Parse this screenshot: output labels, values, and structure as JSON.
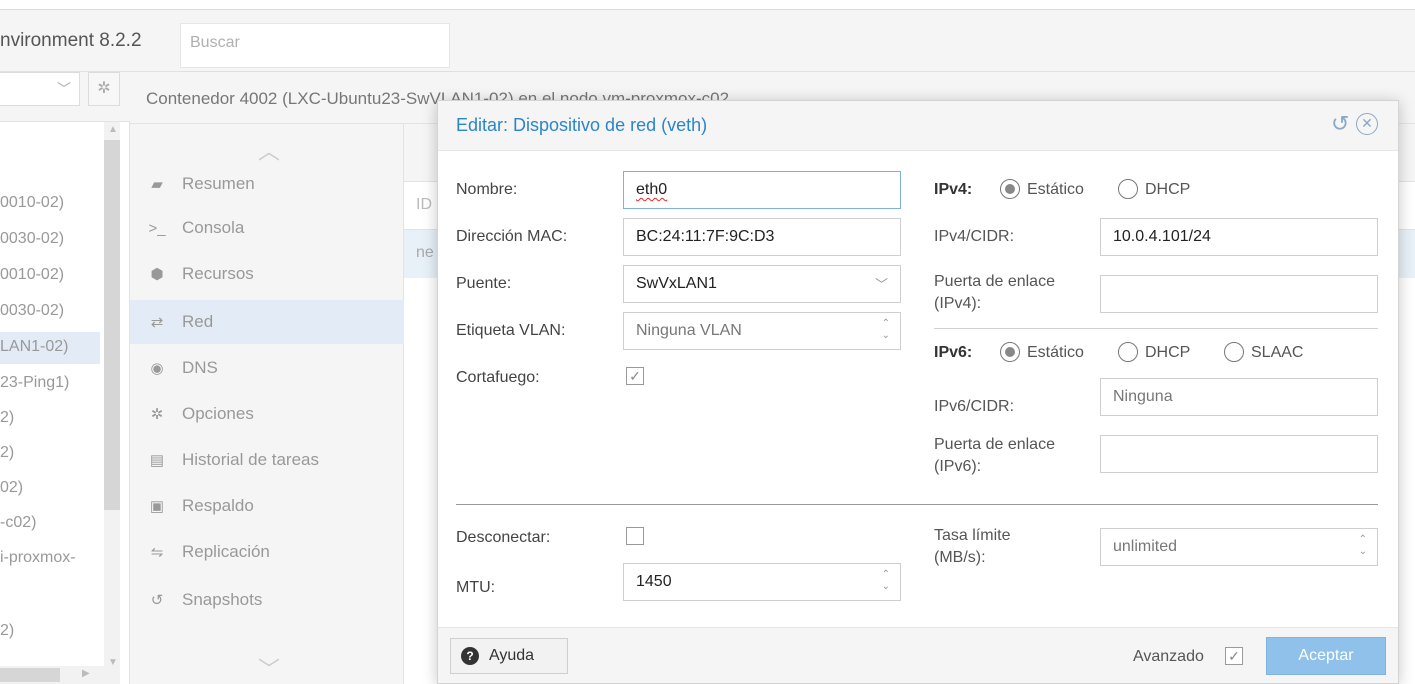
{
  "app": {
    "product_title": "nvironment 8.2.2",
    "search_placeholder": "Buscar"
  },
  "tree": {
    "items": [
      "0010-02)",
      "0030-02)",
      "0010-02)",
      "0030-02)",
      "LAN1-02)",
      "23-Ping1)",
      "2)",
      "2)",
      "02)",
      "-c02)",
      "i-proxmox-",
      "2)"
    ]
  },
  "container": {
    "title": "Contenedor 4002 (LXC-Ubuntu23-SwVLAN1-02) en el nodo vm-proxmox-c02",
    "nav": [
      "Resumen",
      "Consola",
      "Recursos",
      "Red",
      "DNS",
      "Opciones",
      "Historial de tareas",
      "Respaldo",
      "Replicación",
      "Snapshots"
    ],
    "active_nav": "Red",
    "grid_header": "ID",
    "grid_row": "ne"
  },
  "dialog": {
    "title": "Editar: Dispositivo de red (veth)",
    "left": {
      "name_label": "Nombre:",
      "name_value": "eth0",
      "mac_label": "Dirección MAC:",
      "mac_value": "BC:24:11:7F:9C:D3",
      "bridge_label": "Puente:",
      "bridge_value": "SwVxLAN1",
      "vlan_label": "Etiqueta VLAN:",
      "vlan_value": "Ninguna VLAN",
      "firewall_label": "Cortafuego:",
      "firewall_checked": true,
      "disconnect_label": "Desconectar:",
      "disconnect_checked": false,
      "mtu_label": "MTU:",
      "mtu_value": "1450"
    },
    "right": {
      "ipv4_label": "IPv4:",
      "ipv4_options": [
        "Estático",
        "DHCP"
      ],
      "ipv4_selected": "Estático",
      "ipv4_cidr_label": "IPv4/CIDR:",
      "ipv4_cidr_value": "10.0.4.101/24",
      "gw4_label_1": "Puerta de enlace",
      "gw4_label_2": "(IPv4):",
      "gw4_value": "",
      "ipv6_label": "IPv6:",
      "ipv6_options": [
        "Estático",
        "DHCP",
        "SLAAC"
      ],
      "ipv6_selected": "Estático",
      "ipv6_cidr_label": "IPv6/CIDR:",
      "ipv6_cidr_value": "Ninguna",
      "gw6_label_1": "Puerta de enlace",
      "gw6_label_2": "(IPv6):",
      "gw6_value": "",
      "rate_label_1": "Tasa límite",
      "rate_label_2": "(MB/s):",
      "rate_value": "unlimited"
    },
    "footer": {
      "help_label": "Ayuda",
      "advanced_label": "Avanzado",
      "advanced_checked": true,
      "accept_label": "Aceptar"
    }
  }
}
